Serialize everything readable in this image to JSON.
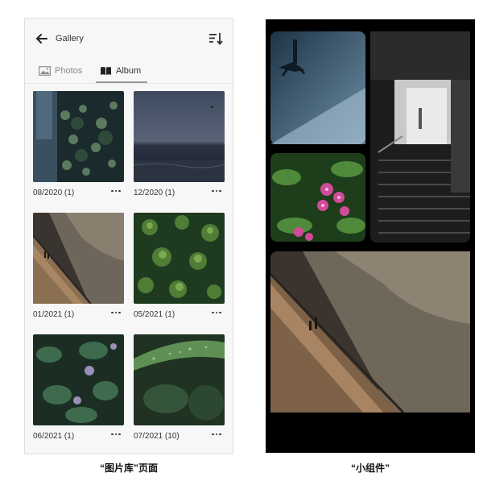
{
  "gallery": {
    "title": "Gallery",
    "tabs": [
      {
        "label": "Photos",
        "active": false
      },
      {
        "label": "Album",
        "active": true
      }
    ],
    "albums": [
      {
        "caption": "08/2020 (1)",
        "theme": "dark-plants"
      },
      {
        "caption": "12/2020 (1)",
        "theme": "stormy-sea"
      },
      {
        "caption": "01/2021 (1)",
        "theme": "river-walk"
      },
      {
        "caption": "05/2021 (1)",
        "theme": "green-leaves"
      },
      {
        "caption": "06/2021 (1)",
        "theme": "purple-flowers"
      },
      {
        "caption": "07/2021 (10)",
        "theme": "water-drop-leaf"
      }
    ]
  },
  "widget": {
    "tiles": [
      "street-walker",
      "subway-stairs",
      "pink-flowers",
      "river-walk"
    ]
  },
  "labels": {
    "gallery_caption": "“图片库”页面",
    "widget_caption": "“小组件”"
  },
  "colors": {
    "background": "#ffffff",
    "panel": "#f7f7f7",
    "widget_bg": "#000000"
  }
}
